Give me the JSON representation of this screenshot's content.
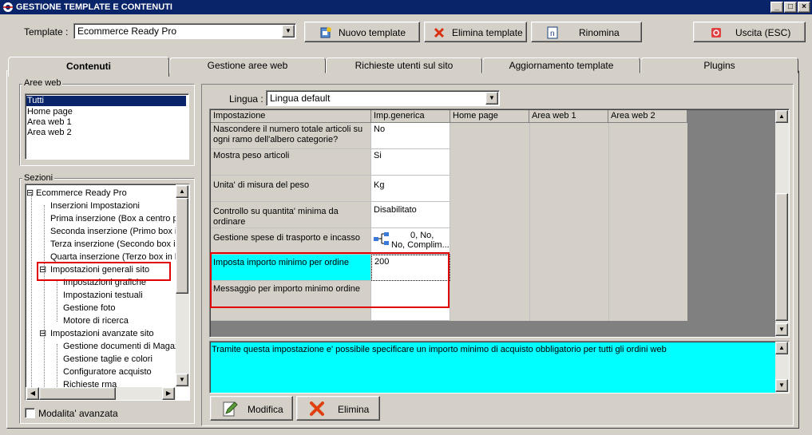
{
  "window": {
    "title": "GESTIONE TEMPLATE E CONTENUTI"
  },
  "toolbar": {
    "template_label": "Template :",
    "template_value": "Ecommerce Ready Pro",
    "nuovo": "Nuovo template",
    "elimina": "Elimina template",
    "rinomina": "Rinomina",
    "uscita": "Uscita (ESC)"
  },
  "tabs": [
    "Contenuti",
    "Gestione aree web",
    "Richieste utenti sul sito",
    "Aggiornamento template",
    "Plugins"
  ],
  "aree_web": {
    "title": "Aree web",
    "items": [
      "Tutti",
      "Home page",
      "Area web 1",
      "Area web 2"
    ]
  },
  "sezioni": {
    "title": "Sezioni",
    "items": [
      "Ecommerce Ready Pro",
      "Inserzioni Impostazioni",
      "Prima inserzione (Box a centro pa",
      "Seconda inserzione (Primo box in",
      "Terza inserzione (Secondo box in",
      "Quarta inserzione (Terzo box in b",
      "Impostazioni generali sito",
      "Impostazioni grafiche",
      "Impostazioni testuali",
      "Gestione foto",
      "Motore di ricerca",
      "Impostazioni avanzate sito",
      "Gestione documenti di Magaz",
      "Gestione taglie e colori",
      "Configuratore acquisto",
      "Richieste rma"
    ],
    "expander_minus": "⊟",
    "modalita": "Modalita' avanzata"
  },
  "lingua": {
    "label": "Lingua :",
    "value": "Lingua default"
  },
  "grid": {
    "headers": [
      "Impostazione",
      "Imp.generica",
      "Home page",
      "Area web 1",
      "Area web 2"
    ],
    "rows": [
      {
        "setting": "Nascondere il numero totale articoli su ogni ramo dell'albero categorie?",
        "value": "No"
      },
      {
        "setting": "Mostra peso articoli",
        "value": "Si"
      },
      {
        "setting": "Unita' di misura del peso",
        "value": "Kg"
      },
      {
        "setting": "Controllo su quantita' minima da ordinare",
        "value": "Disabilitato"
      },
      {
        "setting": "Gestione spese di trasporto e incasso",
        "value": "0, No,",
        "value2": "No, Complim..."
      },
      {
        "setting": "Imposta importo minimo per ordine",
        "value": "200"
      },
      {
        "setting": "Messaggio per importo minimo ordine",
        "value": ""
      }
    ]
  },
  "description": "Tramite questa impostazione e' possibile specificare un importo minimo di acquisto obbligatorio per tutti gli ordini web",
  "actions": {
    "modifica": "Modifica",
    "elimina": "Elimina"
  },
  "colors": {
    "highlight": "#00ffff",
    "selection": "#0a246a",
    "red_frame": "#e00000"
  }
}
